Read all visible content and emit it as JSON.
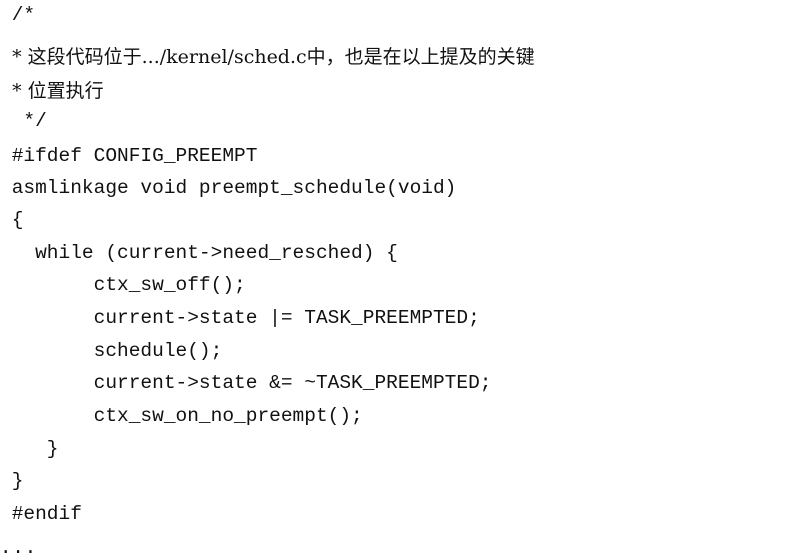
{
  "code": {
    "lines": [
      " /*",
      "  * 这段代码位于.../kernel/sched.c中，也是在以上提及的关键",
      "  * 位置执行",
      "  */",
      " #ifdef CONFIG_PREEMPT",
      " asmlinkage void preempt_schedule(void)",
      " {",
      "   while (current->need_resched) {",
      "        ctx_sw_off();",
      "        current->state |= TASK_PREEMPTED;",
      "        schedule();",
      "        current->state &= ~TASK_PREEMPTED;",
      "        ctx_sw_on_no_preempt();",
      "    }",
      " }",
      " #endif"
    ],
    "trailing_ellipsis": "..."
  }
}
